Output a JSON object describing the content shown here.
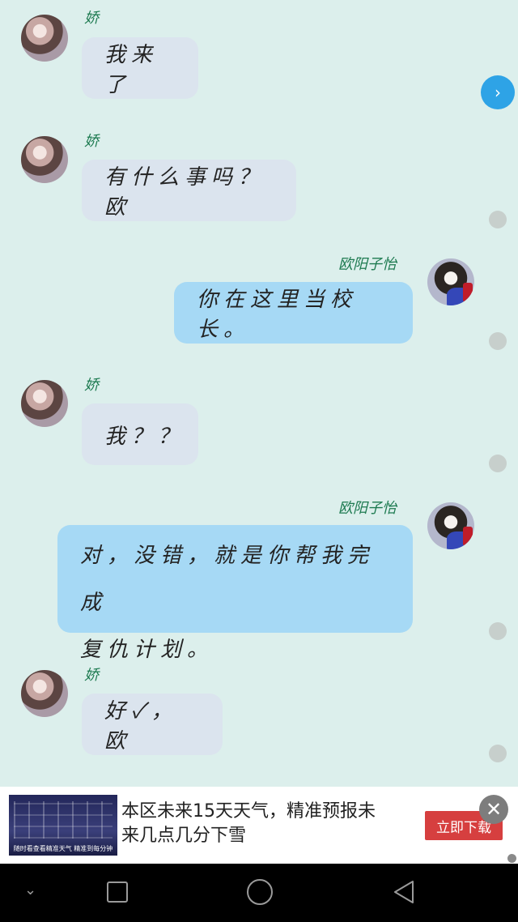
{
  "messages": [
    {
      "side": "left",
      "sender": "娇",
      "text": "我来了"
    },
    {
      "side": "left",
      "sender": "娇",
      "text": "有什么事吗？欧"
    },
    {
      "side": "right",
      "sender": "欧阳子怡",
      "text": "你在这里当校长。"
    },
    {
      "side": "left",
      "sender": "娇",
      "text": "我？？"
    },
    {
      "side": "right",
      "sender": "欧阳子怡",
      "text_line1": "对，没错，就是你帮我完成",
      "text_line2": "复仇计划。"
    },
    {
      "side": "left",
      "sender": "娇",
      "text": "好✓，欧"
    }
  ],
  "next_button_icon": "›",
  "ad": {
    "thumb_caption": "随时看查看精准天气 精准到每分钟",
    "text_line1": "本区未来15天天气，精准预报未",
    "text_line2": "来几点几分下雪",
    "button_label": "立即下载",
    "close_icon": "✕"
  },
  "navbar": {
    "down_icon": "⌄"
  },
  "colors": {
    "background": "#dcefec",
    "left_bubble": "#dbe4ee",
    "right_bubble": "#a6d9f5",
    "sender_name": "#1d7a50",
    "ad_button": "#d63f3f",
    "next_button": "#2ea3e6"
  }
}
